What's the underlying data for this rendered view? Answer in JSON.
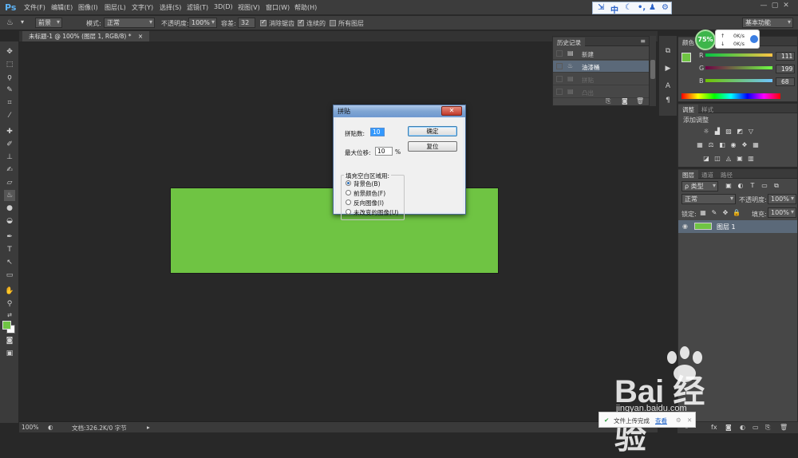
{
  "menubar": {
    "logo": "Ps",
    "items": [
      "文件(F)",
      "编辑(E)",
      "图像(I)",
      "图层(L)",
      "文字(Y)",
      "选择(S)",
      "滤镜(T)",
      "3D(D)",
      "视图(V)",
      "窗口(W)",
      "帮助(H)"
    ],
    "ime": [
      "中",
      "◕",
      "⌘",
      "⚙"
    ],
    "window_buttons": [
      "—",
      "▢",
      "✕"
    ]
  },
  "options": {
    "tool_source": "前景",
    "mode_label": "模式:",
    "mode_value": "正常",
    "opacity_label": "不透明度:",
    "opacity_value": "100%",
    "tolerance_label": "容差:",
    "tolerance_value": "32",
    "antialias_label": "消除锯齿",
    "contiguous_label": "连续的",
    "all_layers_label": "所有图层",
    "workspace": "基本功能"
  },
  "document": {
    "tab_title": "未标题-1 @ 100% (图层 1, RGB/8) *",
    "close": "×"
  },
  "status": {
    "zoom": "100%",
    "doc_info": "文档:326.2K/0 字节"
  },
  "dialog": {
    "title": "拼贴",
    "close": "✕",
    "tile_count_label": "拼贴数:",
    "tile_count_value": "10",
    "max_offset_label": "最大位移:",
    "max_offset_value": "10",
    "percent": "%",
    "ok_label": "确定",
    "reset_label": "复位",
    "fill_group_label": "填充空白区域用:",
    "fill_options": [
      {
        "label": "背景色(B)",
        "selected": true
      },
      {
        "label": "前景颜色(F)",
        "selected": false
      },
      {
        "label": "反向图像(I)",
        "selected": false
      },
      {
        "label": "未改变的图像(U)",
        "selected": false
      }
    ]
  },
  "history": {
    "tab": "历史记录",
    "rows": [
      {
        "label": "新建",
        "icon": "document-icon",
        "dim": false
      },
      {
        "label": "油漆桶",
        "icon": "paint-bucket-icon",
        "dim": false,
        "active": true
      },
      {
        "label": "拼贴",
        "icon": "document-icon",
        "dim": true
      },
      {
        "label": "凸出",
        "icon": "document-icon",
        "dim": true
      }
    ]
  },
  "color": {
    "tab_color": "颜色",
    "r_label": "R",
    "r_value": "111",
    "g_label": "G",
    "g_value": "199",
    "b_label": "B",
    "b_value": "68",
    "fg_color": "#6fc443"
  },
  "adjustments": {
    "tab_adjust": "调整",
    "tab_style": "样式",
    "title": "添加调整"
  },
  "layers": {
    "tab_layers": "图层",
    "tab_channels": "通道",
    "tab_paths": "路径",
    "filter_label": "ρ 类型",
    "blend_mode": "正常",
    "opacity_label": "不透明度:",
    "opacity_value": "100%",
    "lock_label": "锁定:",
    "fill_label": "填充:",
    "fill_value": "100%",
    "layer_name": "图层 1"
  },
  "performance": {
    "percent": "75%",
    "up": "0K/s",
    "down": "0K/s"
  },
  "upload_notice": {
    "text": "文件上传完成",
    "link": "查看"
  },
  "watermark": {
    "brand": "Bai  经验",
    "url": "jingyan.baidu.com"
  }
}
